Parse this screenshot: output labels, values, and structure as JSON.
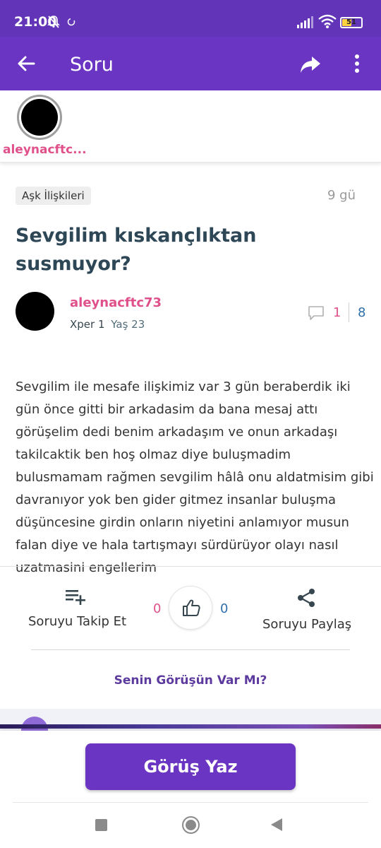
{
  "status_bar": {
    "time": "21:00",
    "battery": "51"
  },
  "app_bar": {
    "title": "Soru",
    "icons": [
      "arrow-back-icon",
      "share-icon",
      "more-vert-icon"
    ]
  },
  "author_strip": {
    "username": "aleynacftc..."
  },
  "question": {
    "category": "Aşk İlişkileri",
    "time_ago": "9 gü",
    "title": "Sevgilim kıskançlıktan susmuyor?",
    "author": {
      "name": "aleynacftc73",
      "level": "Xper 1",
      "age": "Yaş 23"
    },
    "comment_count": "1",
    "view_count": "8",
    "body": "Sevgilim ile mesafe ilişkimiz var 3 gün beraberdik iki gün önce gitti bir arkadasim da bana mesaj attı görüşelim dedi benim arkadaşım ve onun arkadaşı takilcaktik ben hoş olmaz diye buluşmadim bulusmamam rağmen sevgilim hâlâ onu aldatmisim gibi davranıyor yok ben gider gitmez insanlar buluşma düşüncesine girdin onların niyetini anlamıyor musun falan diye ve hala tartışmayı sürdürüyor olayı nasıl uzatmasini engellerim"
  },
  "actions": {
    "follow_label": "Soruyu Takip Et",
    "share_label": "Soruyu Paylaş",
    "like_left": "0",
    "like_right": "0"
  },
  "opinion_prompt": "Senin Görüşün Var Mı?",
  "write_button": "Görüş Yaz",
  "colors": {
    "primary": "#6a35c2",
    "pink": "#e0508a",
    "blue": "#2f6fa8",
    "title_text": "#2e4757"
  }
}
